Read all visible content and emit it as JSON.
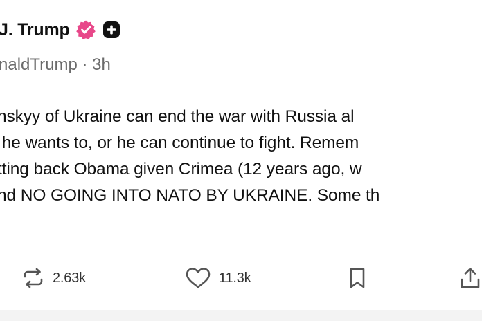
{
  "post": {
    "display_name": "J. Trump",
    "handle": "naldTrump",
    "time_separator": "·",
    "timestamp": "3h",
    "body_lines": [
      "nskyy of Ukraine can end the war with Russia al",
      " he wants to, or he can continue to fight. Remem",
      "tting back Obama given Crimea (12 years ago, w",
      "nd NO GOING INTO NATO BY UKRAINE. Some th"
    ],
    "badges": {
      "verified_color": "#e8488a",
      "verified_icon": "verified-check-icon",
      "app_icon": "plus-square-icon"
    }
  },
  "actions": {
    "repost_count": "2.63k",
    "like_count": "11.3k",
    "repost_icon": "repost-icon",
    "like_icon": "heart-icon",
    "bookmark_icon": "bookmark-icon",
    "share_icon": "share-icon"
  }
}
